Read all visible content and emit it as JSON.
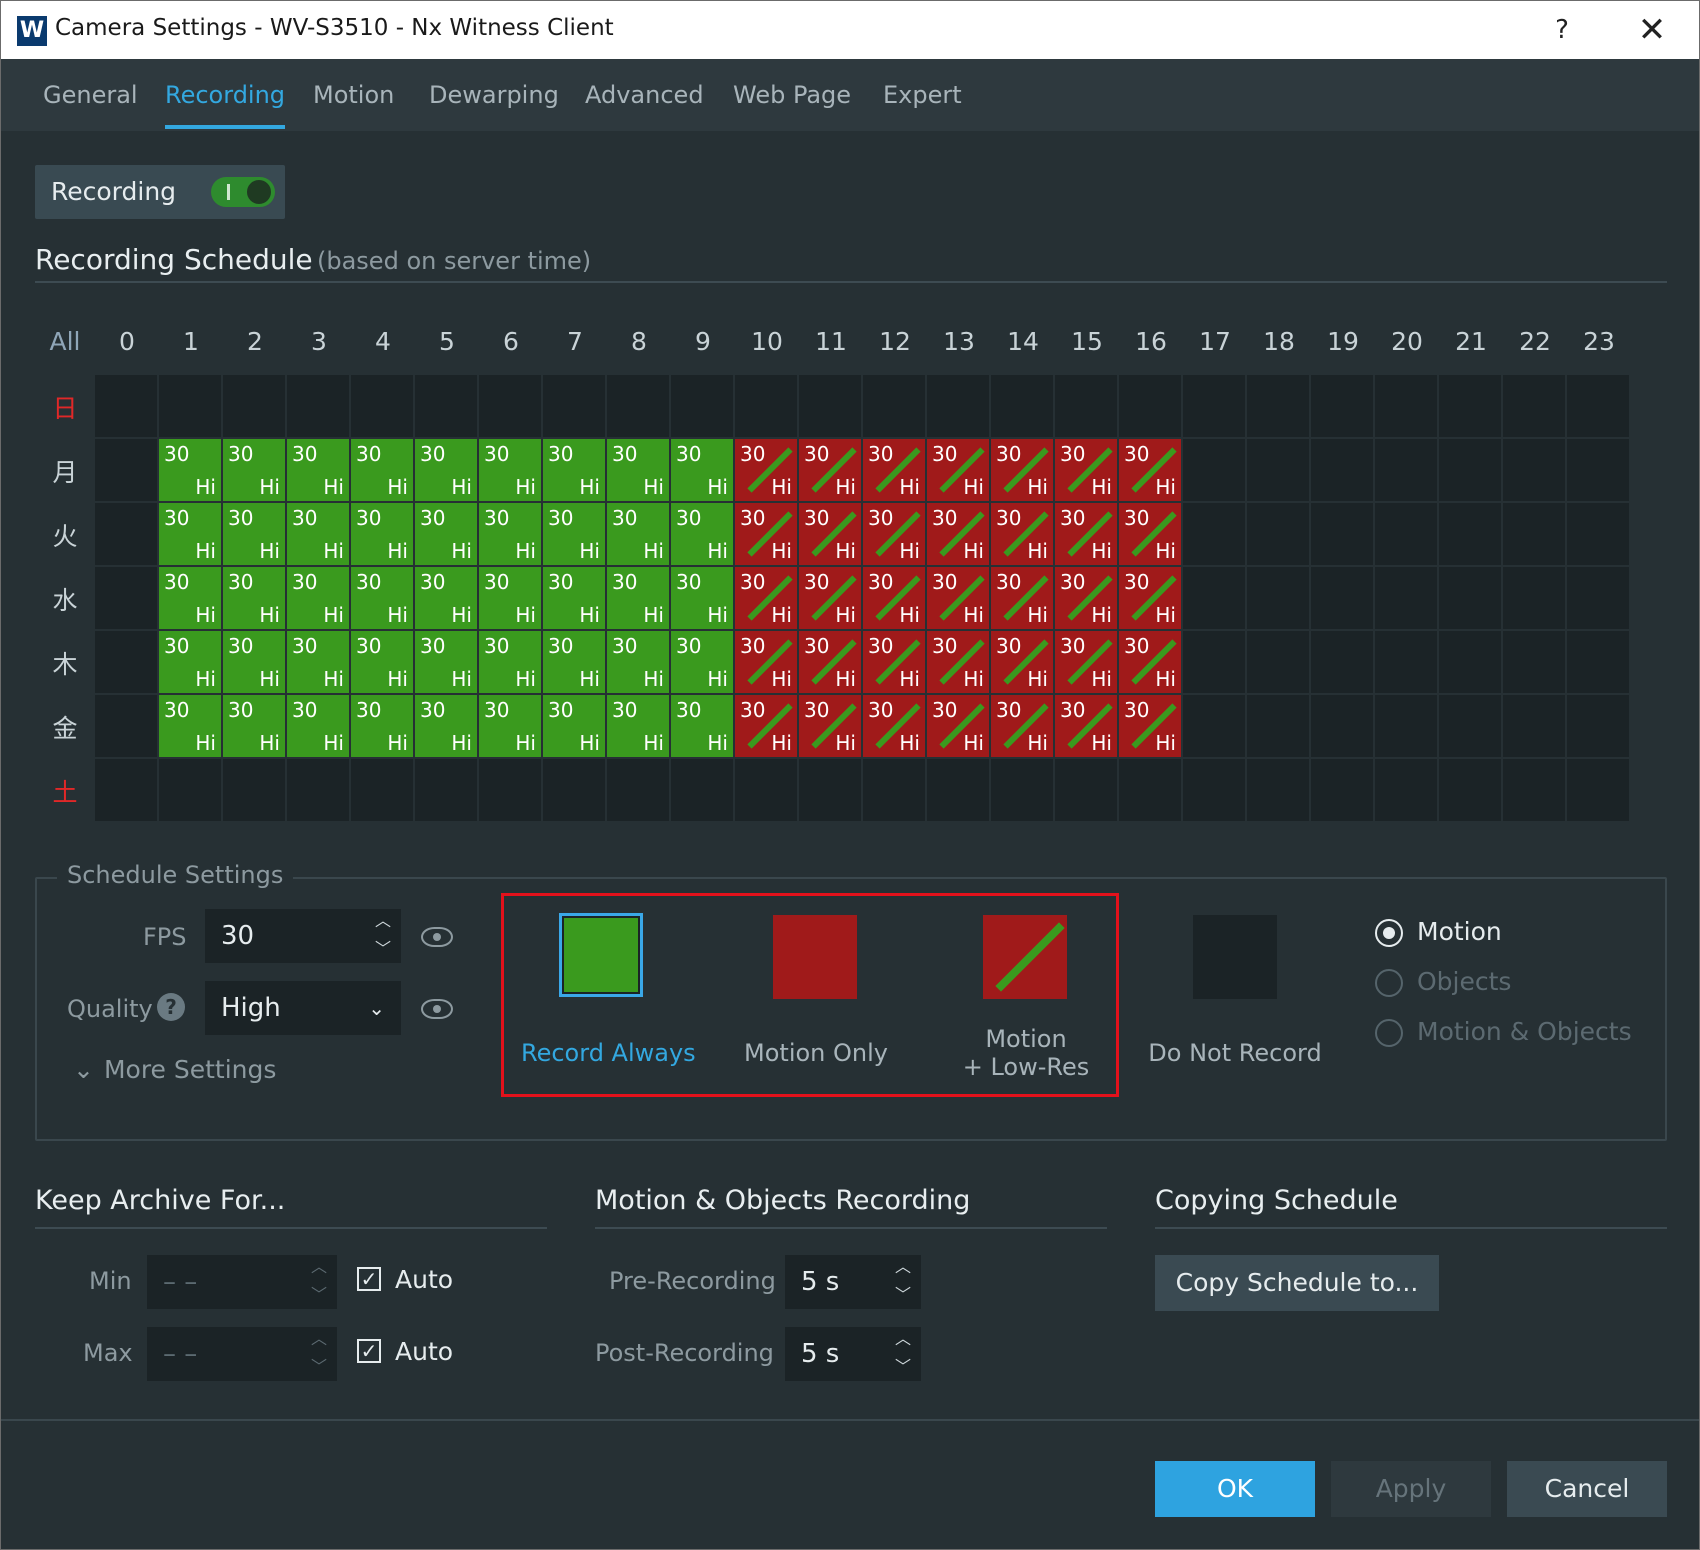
{
  "window": {
    "title": "Camera Settings - WV-S3510 - Nx Witness Client",
    "logo_letter": "W",
    "help": "?",
    "close": "✕"
  },
  "tabs": [
    "General",
    "Recording",
    "Motion",
    "Dewarping",
    "Advanced",
    "Web Page",
    "Expert"
  ],
  "active_tab": "Recording",
  "recording_toggle": {
    "label": "Recording",
    "on": true
  },
  "schedule": {
    "title": "Recording Schedule",
    "subtitle": "(based on server time)",
    "all_label": "All",
    "hours": [
      "0",
      "1",
      "2",
      "3",
      "4",
      "5",
      "6",
      "7",
      "8",
      "9",
      "10",
      "11",
      "12",
      "13",
      "14",
      "15",
      "16",
      "17",
      "18",
      "19",
      "20",
      "21",
      "22",
      "23"
    ],
    "days": [
      "日",
      "月",
      "火",
      "水",
      "木",
      "金",
      "土"
    ],
    "cell_fps": "30",
    "cell_quality": "Hi",
    "colors": {
      "record_always": "#3a9a1e",
      "motion_low_res": "#a01a1a",
      "do_not_record": "#1b2326",
      "weekend_label": "#e02828"
    },
    "rows": [
      "------------------------",
      "-GGGGGGGGGMMMMMMM-------",
      "-GGGGGGGGGMMMMMMM-------",
      "-GGGGGGGGGMMMMMMM-------",
      "-GGGGGGGGGMMMMMMM-------",
      "-GGGGGGGGGMMMMMMM-------",
      "------------------------"
    ]
  },
  "schedule_settings": {
    "title": "Schedule Settings",
    "fps_label": "FPS",
    "fps_value": "30",
    "quality_label": "Quality",
    "quality_value": "High",
    "more_settings": "More Settings",
    "modes": [
      {
        "label": "Record Always",
        "selected": true
      },
      {
        "label": "Motion Only",
        "selected": false
      },
      {
        "label": "Motion",
        "label2": "+ Low-Res",
        "selected": false
      },
      {
        "label": "Do Not Record",
        "selected": false
      }
    ],
    "triggers": [
      {
        "label": "Motion",
        "checked": true
      },
      {
        "label": "Objects",
        "checked": false
      },
      {
        "label": "Motion & Objects",
        "checked": false
      }
    ]
  },
  "keep_archive": {
    "title": "Keep Archive For...",
    "min_label": "Min",
    "min_value": "– –",
    "min_auto": "Auto",
    "max_label": "Max",
    "max_value": "– –",
    "max_auto": "Auto"
  },
  "motion_objects": {
    "title": "Motion & Objects Recording",
    "pre_label": "Pre-Recording",
    "pre_value": "5 s",
    "post_label": "Post-Recording",
    "post_value": "5 s"
  },
  "copying": {
    "title": "Copying Schedule",
    "button": "Copy Schedule to..."
  },
  "footer": {
    "ok": "OK",
    "apply": "Apply",
    "cancel": "Cancel"
  }
}
